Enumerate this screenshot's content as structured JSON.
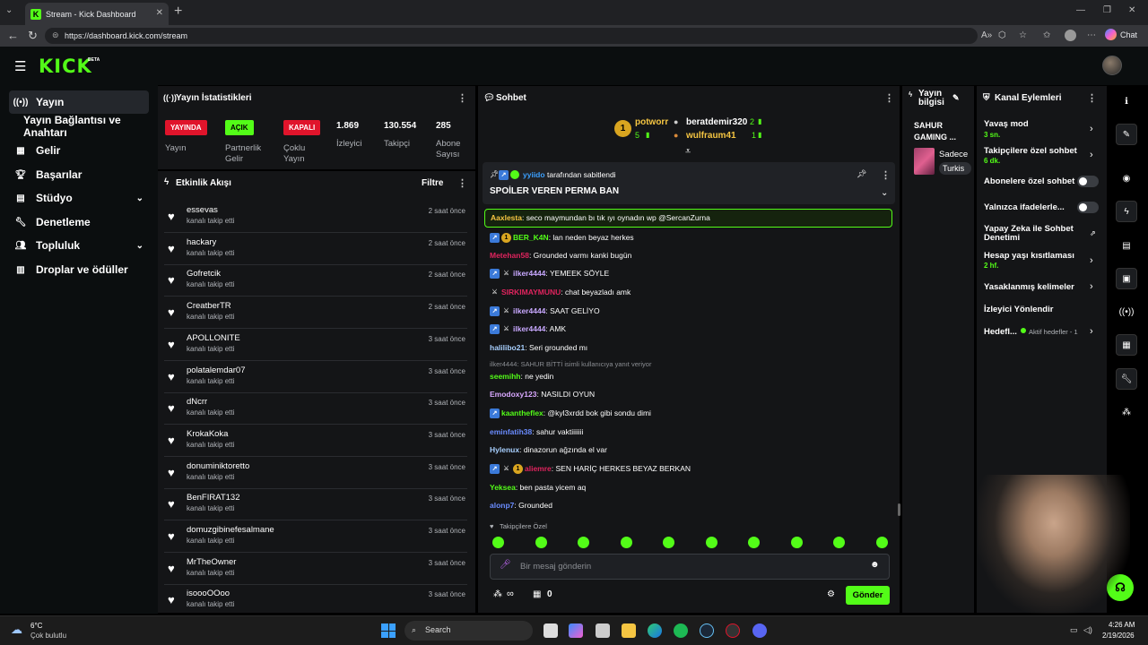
{
  "browser": {
    "tab_title": "Stream - Kick Dashboard",
    "url": "https://dashboard.kick.com/stream",
    "chat_button": "Chat"
  },
  "header": {
    "logo": "KICK",
    "beta": "BETA"
  },
  "sidebar": {
    "items": [
      {
        "label": "Yayın",
        "icon": "broadcast-icon"
      },
      {
        "label": "Yayın Bağlantısı ve Anahtarı"
      },
      {
        "label": "Gelir",
        "icon": "revenue-icon"
      },
      {
        "label": "Başarılar",
        "icon": "trophy-icon"
      },
      {
        "label": "Stüdyo",
        "icon": "studio-icon"
      },
      {
        "label": "Denetleme",
        "icon": "wrench-icon"
      },
      {
        "label": "Topluluk",
        "icon": "community-icon"
      },
      {
        "label": "Droplar ve ödüller",
        "icon": "drops-icon"
      }
    ]
  },
  "stats": {
    "title": "Yayın İstatistikleri",
    "yayin_tag": "YAYINDA",
    "yayin_label": "Yayın",
    "partner_tag": "AÇIK",
    "partner_label": "Partnerlik Gelir",
    "multi_tag": "KAPALI",
    "multi_label": "Çoklu Yayın",
    "viewers": "1.869",
    "viewers_label": "İzleyici",
    "followers": "130.554",
    "followers_label": "Takipçi",
    "subs": "285",
    "subs_label": "Abone Sayısı"
  },
  "activity": {
    "title": "Etkinlik Akışı",
    "filter": "Filtre",
    "items": [
      {
        "name": "essevas",
        "sub": "kanalı takip etti",
        "time": "2 saat önce"
      },
      {
        "name": "hackary",
        "sub": "kanalı takip etti",
        "time": "2 saat önce"
      },
      {
        "name": "Gofretcik",
        "sub": "kanalı takip etti",
        "time": "2 saat önce"
      },
      {
        "name": "CreatberTR",
        "sub": "kanalı takip etti",
        "time": "2 saat önce"
      },
      {
        "name": "APOLLONITE",
        "sub": "kanalı takip etti",
        "time": "3 saat önce"
      },
      {
        "name": "polatalemdar07",
        "sub": "kanalı takip etti",
        "time": "3 saat önce"
      },
      {
        "name": "dNcrr",
        "sub": "kanalı takip etti",
        "time": "3 saat önce"
      },
      {
        "name": "KrokaKoka",
        "sub": "kanalı takip etti",
        "time": "3 saat önce"
      },
      {
        "name": "donuminiktoretto",
        "sub": "kanalı takip etti",
        "time": "3 saat önce"
      },
      {
        "name": "BenFIRAT132",
        "sub": "kanalı takip etti",
        "time": "3 saat önce"
      },
      {
        "name": "domuzgibinefesalmane",
        "sub": "kanalı takip etti",
        "time": "3 saat önce"
      },
      {
        "name": "MrTheOwner",
        "sub": "kanalı takip etti",
        "time": "3 saat önce"
      },
      {
        "name": "isoooOOoo",
        "sub": "kanalı takip etti",
        "time": "3 saat önce"
      }
    ]
  },
  "chat": {
    "title": "Sohbet",
    "leaders": {
      "first_name": "potworr",
      "first_count": "5",
      "second_name": "beratdemir320",
      "second_count": "2",
      "third_name": "wulfraum41",
      "third_count": "1"
    },
    "pinned_by_user": "yyiido",
    "pinned_by_text": "tarafından sabitlendi",
    "pinned_message": "SPOİLER VEREN PERMA BAN",
    "highlight": {
      "user": "Aaxlesta",
      "text": "seco maymundan bı tık ıyı oynadın wp @SercanZurna"
    },
    "messages": [
      {
        "user": "BER_K4N",
        "color": "#53fc18",
        "text": "lan neden beyaz herkes"
      },
      {
        "user": "Metehan58",
        "color": "#e0245e",
        "text": "Grounded varmı kanki bugün"
      },
      {
        "user": "ilker4444",
        "color": "#c8a8ff",
        "text": "YEMEEK SÖYLE"
      },
      {
        "user": "SIRKIMAYMUNU",
        "color": "#e0245e",
        "text": "chat beyazladı amk"
      },
      {
        "user": "ilker4444",
        "color": "#c8a8ff",
        "text": "SAAT GELİYO"
      },
      {
        "user": "ilker4444",
        "color": "#c8a8ff",
        "text": "AMK"
      },
      {
        "user": "halilibo21",
        "color": "#a8d0ff",
        "text": "Seri grounded mı"
      },
      {
        "user": "seemihh",
        "color": "#53fc18",
        "text": "ne yedin"
      },
      {
        "user": "Emodoxy123",
        "color": "#d9a8ff",
        "text": "NASILDI OYUN"
      },
      {
        "user": "kaantheflex",
        "color": "#53fc18",
        "text": "@kyl3xrdd bok gibi sondu dimi"
      },
      {
        "user": "eminfatih38",
        "color": "#6a8cff",
        "text": "sahur vaktiiiiiii"
      },
      {
        "user": "Hylenux",
        "color": "#a8d0ff",
        "text": "dinazorun ağzında el var"
      },
      {
        "user": "aliemre",
        "color": "#e0245e",
        "text": "SEN HARİÇ HERKES BEYAZ BERKAN"
      },
      {
        "user": "Yeksea",
        "color": "#53fc18",
        "text": "ben pasta yicem aq"
      },
      {
        "user": "alonp7",
        "color": "#6a8cff",
        "text": "Grounded"
      }
    ],
    "reply_note": "ilker4444: SAHUR BİTTİ isimli kullanıcıya yanıt veriyor",
    "followers_only": "Takipçilere Özel",
    "input_placeholder": "Bir mesaj gönderin",
    "points": "0",
    "send": "Gönder"
  },
  "stream_info": {
    "title": "Yayın bilgisi",
    "stream_title": "SAHUR GAMING ...",
    "category": "Sadece",
    "language": "Turkis"
  },
  "actions": {
    "title": "Kanal Eylemleri",
    "slow_mode": "Yavaş mod",
    "slow_val": "3 sn.",
    "followers_chat": "Takipçilere özel sohbet",
    "followers_val": "6 dk.",
    "subs_chat": "Abonelere özel sohbet",
    "emotes_only": "Yalnızca ifadelerle...",
    "ai_mod": "Yapay Zeka ile Sohbet Denetimi",
    "age_limit": "Hesap yaşı kısıtlaması",
    "age_val": "2 hf.",
    "banned_words": "Yasaklanmış kelimeler",
    "redirect": "İzleyici Yönlendir",
    "goals": "Hedefl...",
    "goals_val": "Aktif hedefler - 1"
  },
  "taskbar": {
    "temp": "6°C",
    "weather": "Çok bulutlu",
    "search": "Search",
    "time": "4:26 AM",
    "date": "2/19/2026"
  }
}
